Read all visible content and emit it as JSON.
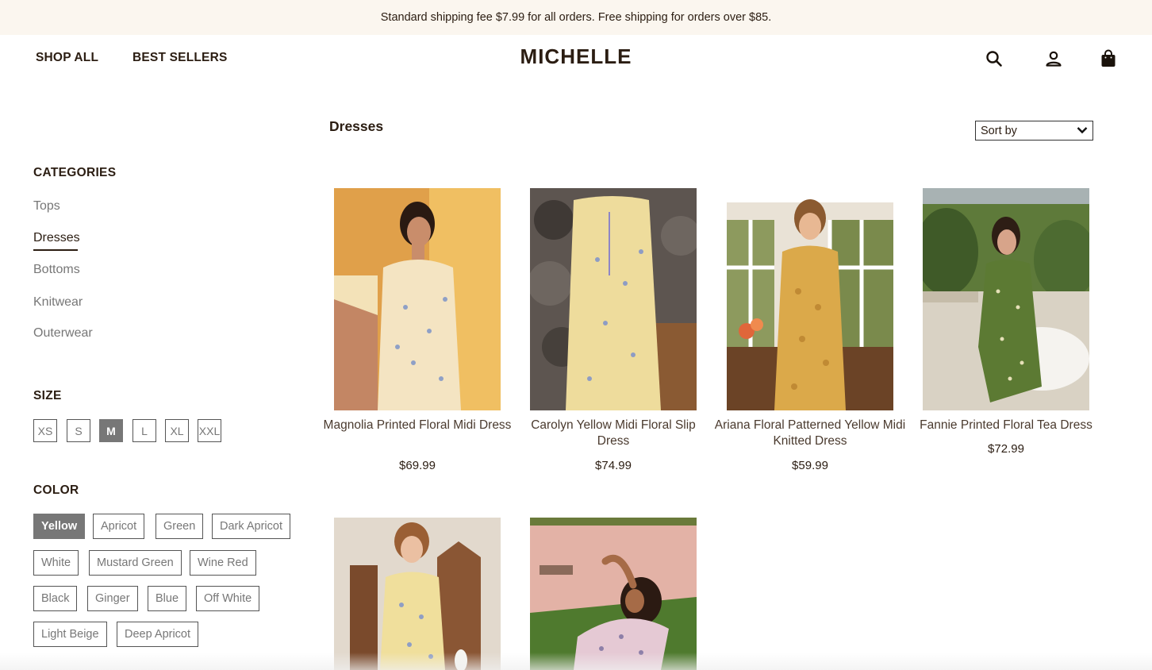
{
  "announcement": "Standard shipping fee $7.99 for all orders. Free shipping for orders over $85.",
  "header": {
    "nav": [
      "SHOP ALL",
      "BEST SELLERS"
    ],
    "logo": "MICHELLE",
    "icons": [
      "search-icon",
      "account-icon",
      "shopping-bag-icon"
    ]
  },
  "page": {
    "title": "Dresses",
    "sort_label": "Sort by"
  },
  "filters": {
    "categories_title": "CATEGORIES",
    "categories": [
      "Tops",
      "Dresses",
      "Bottoms",
      "Knitwear",
      "Outerwear"
    ],
    "active_category": "Dresses",
    "size_title": "SIZE",
    "sizes": [
      "XS",
      "S",
      "M",
      "L",
      "XL",
      "XXL"
    ],
    "active_size": "M",
    "color_title": "COLOR",
    "colors": [
      "Yellow",
      "Apricot",
      "Green",
      "Dark Apricot",
      "White",
      "Mustard Green",
      "Wine Red",
      "Black",
      "Ginger",
      "Blue",
      "Off White",
      "Light Beige",
      "Deep Apricot"
    ],
    "active_color": "Yellow"
  },
  "products": [
    {
      "name": "Magnolia Printed Floral Midi Dress",
      "price": "$69.99"
    },
    {
      "name": "Carolyn Yellow Midi Floral Slip Dress",
      "price": "$74.99"
    },
    {
      "name": "Ariana Floral Patterned Yellow Midi Knitted Dress",
      "price": "$59.99"
    },
    {
      "name": "Fannie Printed Floral Tea Dress",
      "price": "$72.99"
    },
    {
      "name": "",
      "price": ""
    },
    {
      "name": "",
      "price": ""
    }
  ],
  "colors": {
    "text": "#2b1d12",
    "muted": "#777777",
    "announcement_bg": "#fbf6ef",
    "active_chip": "#777777"
  }
}
